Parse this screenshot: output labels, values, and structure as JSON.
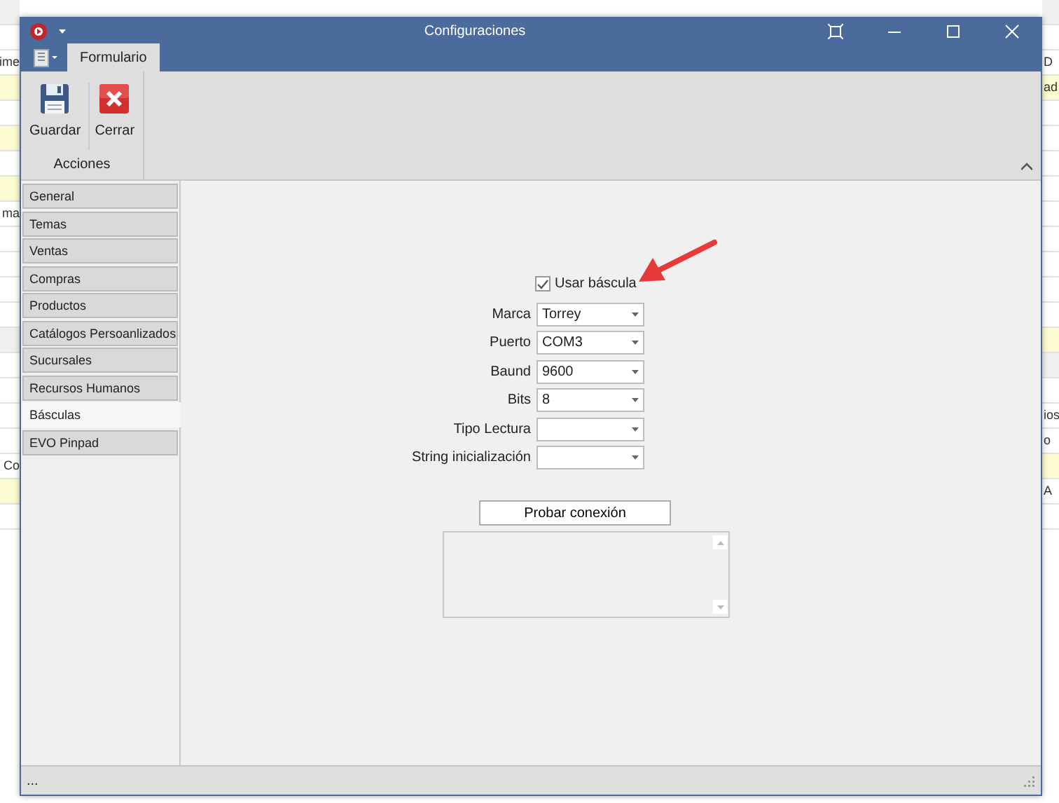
{
  "background": {
    "left_rows": [
      {
        "kind": "gray"
      },
      {
        "kind": "white"
      },
      {
        "kind": "white",
        "text": "ime"
      },
      {
        "kind": "yellow"
      },
      {
        "kind": "white"
      },
      {
        "kind": "yellow"
      },
      {
        "kind": "white"
      },
      {
        "kind": "yellow"
      },
      {
        "kind": "white",
        "text": "ma"
      },
      {
        "kind": "white"
      },
      {
        "kind": "white"
      },
      {
        "kind": "white"
      },
      {
        "kind": "white"
      },
      {
        "kind": "gray"
      },
      {
        "kind": "white"
      },
      {
        "kind": "white"
      },
      {
        "kind": "white"
      },
      {
        "kind": "white"
      },
      {
        "kind": "white",
        "text": "Co"
      },
      {
        "kind": "yellow"
      },
      {
        "kind": "white"
      }
    ],
    "right_rows": [
      {
        "kind": "gray"
      },
      {
        "kind": "white"
      },
      {
        "kind": "white",
        "text": "D"
      },
      {
        "kind": "yellow",
        "text": "ad"
      },
      {
        "kind": "white"
      },
      {
        "kind": "white"
      },
      {
        "kind": "white"
      },
      {
        "kind": "white"
      },
      {
        "kind": "white"
      },
      {
        "kind": "white"
      },
      {
        "kind": "white"
      },
      {
        "kind": "white"
      },
      {
        "kind": "white"
      },
      {
        "kind": "yellow"
      },
      {
        "kind": "gray"
      },
      {
        "kind": "white"
      },
      {
        "kind": "white",
        "text": "ios"
      },
      {
        "kind": "white",
        "text": "o"
      },
      {
        "kind": "yellow"
      },
      {
        "kind": "white",
        "text": "A"
      },
      {
        "kind": "white"
      }
    ]
  },
  "window": {
    "title": "Configuraciones"
  },
  "ribbon": {
    "tabs": [
      {
        "label": "Formulario",
        "selected": true
      }
    ],
    "groups": [
      {
        "label": "Acciones",
        "buttons": [
          {
            "label": "Guardar",
            "kind": "save"
          },
          {
            "label": "Cerrar",
            "kind": "close"
          }
        ]
      }
    ]
  },
  "sidebar": {
    "items": [
      {
        "label": "General",
        "selected": false
      },
      {
        "label": "Temas",
        "selected": false
      },
      {
        "label": "Ventas",
        "selected": false
      },
      {
        "label": "Compras",
        "selected": false
      },
      {
        "label": "Productos",
        "selected": false
      },
      {
        "label": "Catálogos Persoanlizados",
        "selected": false
      },
      {
        "label": "Sucursales",
        "selected": false
      },
      {
        "label": "Recursos Humanos",
        "selected": false
      },
      {
        "label": "Básculas",
        "selected": true
      },
      {
        "label": "EVO Pinpad",
        "selected": false
      }
    ]
  },
  "form": {
    "enable": {
      "label": "Usar báscula",
      "checked": true
    },
    "fields": [
      {
        "label": "Marca",
        "value": "Torrey"
      },
      {
        "label": "Puerto",
        "value": "COM3"
      },
      {
        "label": "Baund",
        "value": "9600"
      },
      {
        "label": "Bits",
        "value": "8"
      },
      {
        "label": "Tipo Lectura"
      },
      {
        "label": "String inicialización"
      }
    ],
    "test_button": "Probar conexión"
  },
  "status_bar": {
    "text": "..."
  }
}
